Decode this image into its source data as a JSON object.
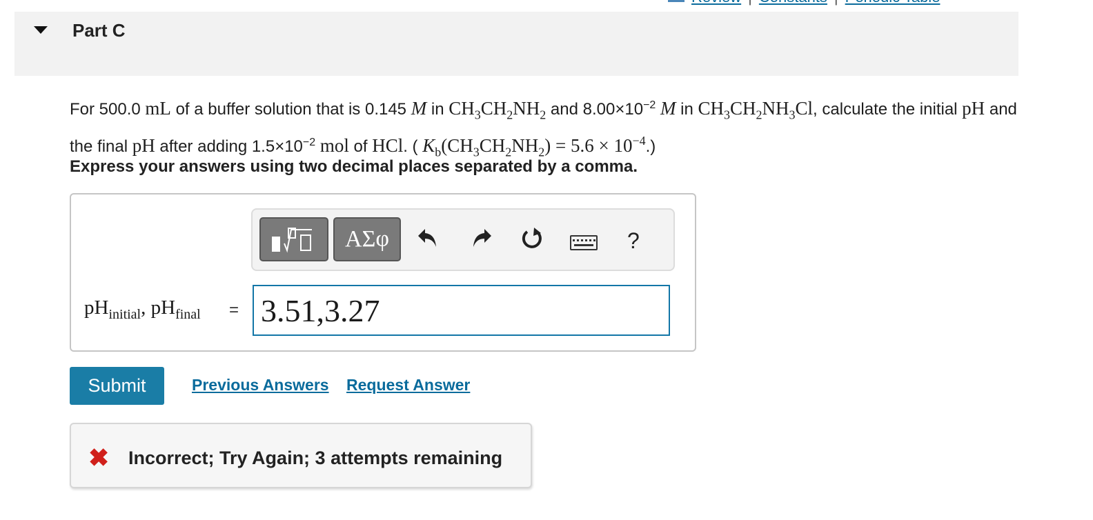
{
  "top_links": {
    "review": "Review",
    "constants": "Constants",
    "periodic_table": "Periodic Table",
    "separator": "|"
  },
  "part": {
    "title": "Part C"
  },
  "question": {
    "t1": "For 500.0 ",
    "v_ml": "mL",
    "t2": " of a buffer solution that is 0.145 ",
    "v_m": "M",
    "t3": " in ",
    "t4": " and 8.00×10",
    "exp_neg2": "−2",
    "t5": " in ",
    "t6": ", calculate the initial ",
    "v_ph": "pH",
    "t7": " and the final ",
    "v_ph2": "pH",
    "t8": " after adding 1.5×10",
    "t9": " of ",
    "v_mol": "mol",
    "v_hcl": "HCl",
    "t10": ". ( ",
    "kb_value": " = 5.6 × 10",
    "exp_neg4": "−4",
    "t11": ".)"
  },
  "instruction": "Express your answers using two decimal places separated by a comma.",
  "toolbar": {
    "greek_label": "ΑΣφ",
    "help_label": "?"
  },
  "answer": {
    "label_ph": "pH",
    "label_initial": "initial",
    "label_sep": ", ",
    "label_final": "final",
    "equals": "=",
    "value": "3.51,3.27"
  },
  "actions": {
    "submit": "Submit",
    "previous_answers": "Previous Answers",
    "request_answer": "Request Answer"
  },
  "feedback": {
    "message": "Incorrect; Try Again; 3 attempts remaining"
  },
  "colors": {
    "accent": "#1a7da6",
    "link": "#0a6b9c",
    "error": "#d0201b"
  }
}
